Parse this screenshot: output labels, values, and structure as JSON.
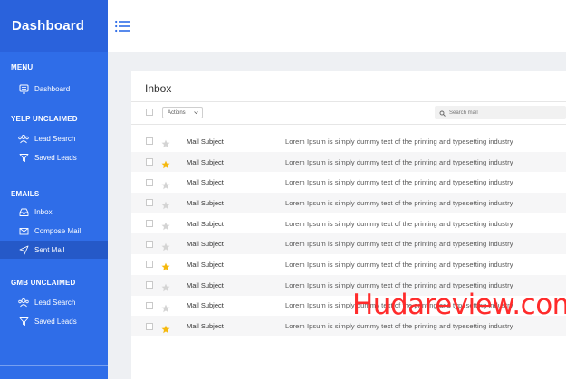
{
  "brand": "Dashboard",
  "colors": {
    "sidebar": "#2f6de8",
    "brand_bg": "#2a62dc",
    "active": "#2559c8",
    "star_on": "#f5b90f",
    "star_off": "#d4d4d4",
    "watermark": "#ff2b2b"
  },
  "sidebar": {
    "menu": {
      "title": "MENU",
      "items": [
        {
          "label": "Dashboard",
          "icon": "dashboard-icon"
        }
      ]
    },
    "yelp": {
      "title": "YELP UNCLAIMED",
      "items": [
        {
          "label": "Lead Search",
          "icon": "users-icon"
        },
        {
          "label": "Saved Leads",
          "icon": "filter-icon"
        }
      ]
    },
    "emails": {
      "title": "EMAILS",
      "items": [
        {
          "label": "Inbox",
          "icon": "inbox-icon"
        },
        {
          "label": "Compose Mail",
          "icon": "mail-icon"
        },
        {
          "label": "Sent Mail",
          "icon": "send-icon",
          "active": true
        }
      ]
    },
    "gmb": {
      "title": "GMB UNCLAIMED",
      "items": [
        {
          "label": "Lead Search",
          "icon": "users-icon"
        },
        {
          "label": "Saved Leads",
          "icon": "filter-icon"
        }
      ]
    }
  },
  "inbox": {
    "title": "Inbox",
    "actions_label": "Actions",
    "search_placeholder": "Search mail",
    "rows": [
      {
        "subject": "Mail Subject",
        "preview": "Lorem Ipsum is simply dummy text of the printing and typesetting industry",
        "starred": false
      },
      {
        "subject": "Mail Subject",
        "preview": "Lorem Ipsum is simply dummy text of the printing and typesetting industry",
        "starred": true
      },
      {
        "subject": "Mail Subject",
        "preview": "Lorem Ipsum is simply dummy text of the printing and typesetting industry",
        "starred": false
      },
      {
        "subject": "Mail Subject",
        "preview": "Lorem Ipsum is simply dummy text of the printing and typesetting industry",
        "starred": false
      },
      {
        "subject": "Mail Subject",
        "preview": "Lorem Ipsum is simply dummy text of the printing and typesetting industry",
        "starred": false
      },
      {
        "subject": "Mail Subject",
        "preview": "Lorem Ipsum is simply dummy text of the printing and typesetting industry",
        "starred": false
      },
      {
        "subject": "Mail Subject",
        "preview": "Lorem Ipsum is simply dummy text of the printing and typesetting industry",
        "starred": true
      },
      {
        "subject": "Mail Subject",
        "preview": "Lorem Ipsum is simply dummy text of the printing and typesetting industry",
        "starred": false
      },
      {
        "subject": "Mail Subject",
        "preview": "Lorem Ipsum is simply dummy text of the printing and typesetting industry",
        "starred": false
      },
      {
        "subject": "Mail Subject",
        "preview": "Lorem Ipsum is simply dummy text of the printing and typesetting industry",
        "starred": true
      }
    ]
  },
  "watermark": "Hudareview.com"
}
